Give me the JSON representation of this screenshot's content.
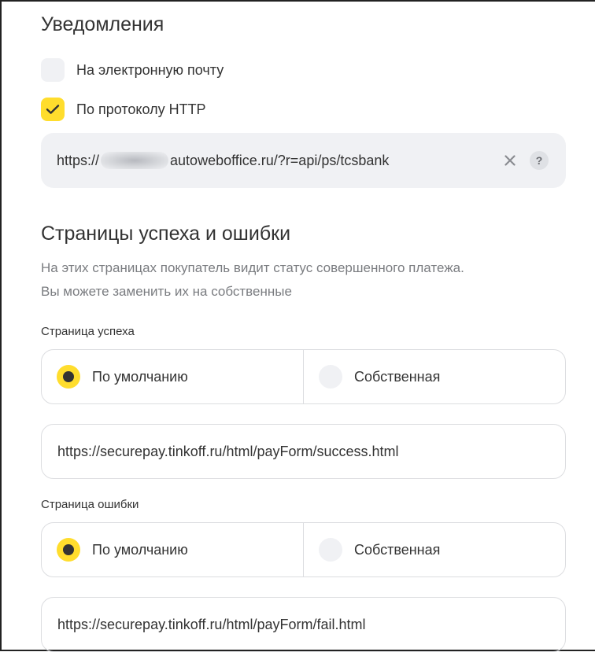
{
  "notifications": {
    "title": "Уведомления",
    "email_label": "На электронную почту",
    "email_checked": false,
    "http_label": "По протоколу HTTP",
    "http_checked": true,
    "http_url_prefix": "https://",
    "http_url_suffix": "autoweboffice.ru/?r=api/ps/tcsbank",
    "help_icon": "?",
    "clear_icon": "close-icon"
  },
  "pages": {
    "title": "Страницы успеха и ошибки",
    "description_line1": "На этих страницах покупатель видит статус совершенного платежа.",
    "description_line2": "Вы можете заменить их на собственные",
    "success": {
      "label": "Страница успеха",
      "option_default": "По умолчанию",
      "option_custom": "Собственная",
      "selected": "default",
      "url": "https://securepay.tinkoff.ru/html/payForm/success.html"
    },
    "fail": {
      "label": "Страница ошибки",
      "option_default": "По умолчанию",
      "option_custom": "Собственная",
      "selected": "default",
      "url": "https://securepay.tinkoff.ru/html/payForm/fail.html"
    }
  },
  "colors": {
    "accent": "#ffdd2d",
    "field_bg": "#f0f1f4",
    "border": "#dcdde0",
    "text": "#333333",
    "muted": "#7a7c80"
  }
}
